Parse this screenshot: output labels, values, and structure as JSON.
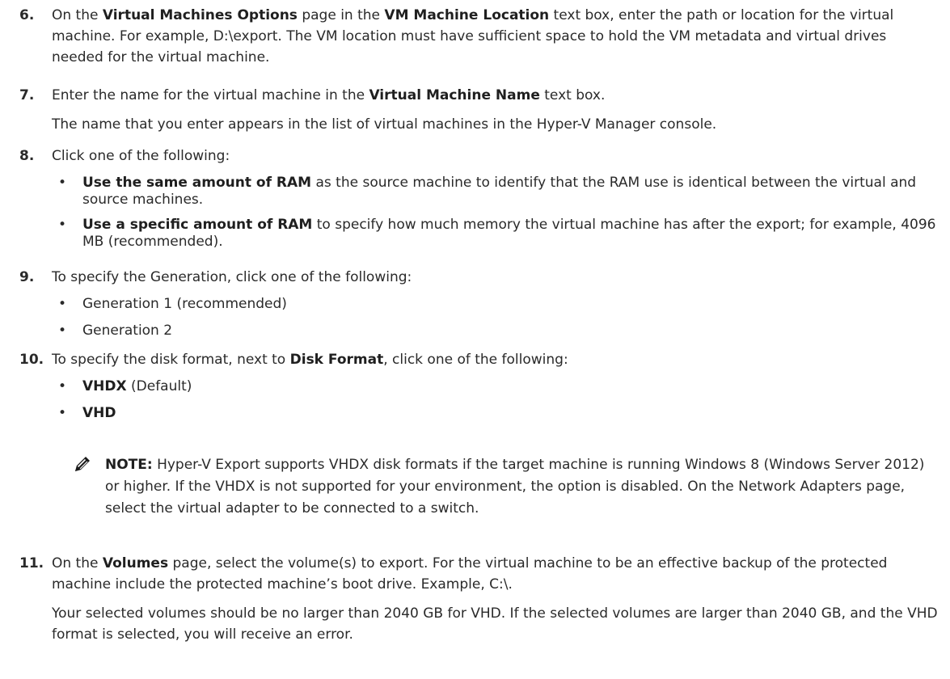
{
  "steps": [
    {
      "num": "6.",
      "a": "On the ",
      "b1": "Virtual Machines Options",
      "c": " page in the ",
      "b2": "VM Machine Location",
      "d": " text box, enter the path or location for the virtual machine. For example, D:\\export. The VM location must have sufficient space to hold the VM metadata and virtual drives needed for the virtual machine."
    },
    {
      "num": "7.",
      "a": "Enter the name for the virtual machine in the ",
      "b1": "Virtual Machine Name",
      "c": " text box.",
      "p2": "The name that you enter appears in the list of virtual machines in the Hyper-V Manager console."
    },
    {
      "num": "8.",
      "text": "Click one of the following:",
      "bullets": [
        {
          "bold": "Use the same amount of RAM",
          "rest": " as the source machine to identify that the RAM use is identical between the virtual and source machines."
        },
        {
          "bold": "Use a specific amount of RAM",
          "rest": " to specify how much memory the virtual machine has after the export; for example, 4096 MB (recommended)."
        }
      ]
    },
    {
      "num": "9.",
      "text": "To specify the Generation, click one of the following:",
      "bullets": [
        {
          "rest": "Generation 1 (recommended)"
        },
        {
          "rest": "Generation 2"
        }
      ]
    },
    {
      "num": "10.",
      "a": "To specify the disk format, next to ",
      "b1": "Disk Format",
      "c": ", click one of the following:",
      "bullets": [
        {
          "bold": "VHDX",
          "rest": " (Default)"
        },
        {
          "bold": "VHD",
          "rest": ""
        }
      ]
    },
    {
      "num": "11.",
      "a": "On the ",
      "b1": "Volumes",
      "c": " page, select the volume(s) to export. For the virtual machine to be an effective backup of the protected machine include the protected machine’s boot drive. Example, C:\\.",
      "p2": "Your selected volumes should be no larger than 2040 GB for VHD. If the selected volumes are larger than 2040 GB, and the VHD format is selected, you will receive an error."
    }
  ],
  "note": {
    "label": "NOTE:",
    "text": " Hyper-V Export supports VHDX disk formats if the target machine is running Windows 8 (Windows Server 2012) or higher. If the VHDX is not supported for your environment, the option is disabled. On the Network Adapters page, select the virtual adapter to be connected to a switch.",
    "icon": "pencil-icon"
  },
  "bullet_glyph": "•"
}
